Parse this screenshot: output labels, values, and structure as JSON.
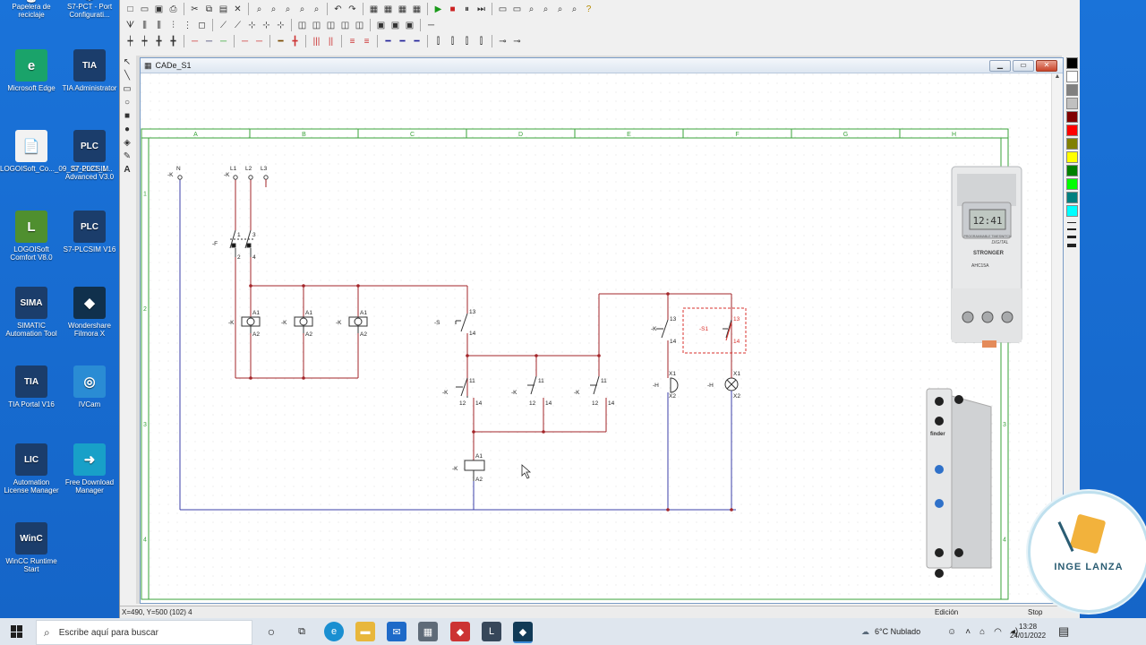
{
  "desktop_icons": [
    {
      "label": "Papelera de reciclaje",
      "icon": "recycle-bin-icon",
      "color": "#8fa4b8",
      "glyph": "🗑"
    },
    {
      "label": "S7-PCT - Port Configurati...",
      "icon": "s7-pct-icon",
      "color": "#2e6aa8",
      "glyph": "⚙"
    },
    {
      "label": "Microsoft Edge",
      "icon": "edge-icon",
      "color": "#1aa36a",
      "glyph": "e"
    },
    {
      "label": "TIA Administrator",
      "icon": "tia-admin-icon",
      "color": "#1b3d6b",
      "glyph": "TIA"
    },
    {
      "label": "LOGOISoft_Co..._09_27_2021_1...",
      "icon": "document-icon",
      "color": "#f2f2f2",
      "glyph": "📄"
    },
    {
      "label": "S7-PLCSIM Advanced V3.0",
      "icon": "plcsim-adv-icon",
      "color": "#1b3d6b",
      "glyph": "PLC"
    },
    {
      "label": "LOGOISoft Comfort V8.0",
      "icon": "logosoft-icon",
      "color": "#4f8f2f",
      "glyph": "L"
    },
    {
      "label": "S7-PLCSIM V16",
      "icon": "plcsim-icon",
      "color": "#1b3d6b",
      "glyph": "PLC"
    },
    {
      "label": "SIMATIC Automation Tool",
      "icon": "simatic-icon",
      "color": "#1b3d6b",
      "glyph": "SIMA"
    },
    {
      "label": "Wondershare Filmora X",
      "icon": "filmora-icon",
      "color": "#10304c",
      "glyph": "◆"
    },
    {
      "label": "TIA Portal V16",
      "icon": "tia-portal-icon",
      "color": "#1b3d6b",
      "glyph": "TIA"
    },
    {
      "label": "IVCam",
      "icon": "ivcam-icon",
      "color": "#2a8cd4",
      "glyph": "◎"
    },
    {
      "label": "Automation License Manager",
      "icon": "license-icon",
      "color": "#1b3d6b",
      "glyph": "LIC"
    },
    {
      "label": "Free Download Manager",
      "icon": "fdm-icon",
      "color": "#18a0c8",
      "glyph": "➜"
    },
    {
      "label": "WinCC Runtime Start",
      "icon": "wincc-icon",
      "color": "#1b3d6b",
      "glyph": "WinC"
    }
  ],
  "document": {
    "title": "CADe_S1",
    "columns": [
      "A",
      "B",
      "C",
      "D",
      "E",
      "F",
      "G",
      "H"
    ],
    "rows": [
      "1",
      "2",
      "3",
      "4"
    ]
  },
  "schematic": {
    "labels": {
      "kn": "-K",
      "n": "N",
      "kl": "-K",
      "l1": "L1",
      "l2": "L2",
      "l3": "L3",
      "f": "-F",
      "f1": "1",
      "f2": "2",
      "f3": "3",
      "f4": "4",
      "k1": "-K",
      "k1a1": "A1",
      "k1a2": "A2",
      "k2": "-K",
      "k2a1": "A1",
      "k2a2": "A2",
      "k3": "-K",
      "k3a1": "A1",
      "k3a2": "A2",
      "s": "-S",
      "s13": "13",
      "s14": "14",
      "ka": "-K",
      "ka11": "11",
      "ka12": "12",
      "ka14": "14",
      "kb": "-K",
      "kb11": "11",
      "kb12": "12",
      "kb14": "14",
      "kc": "-K",
      "kc11": "11",
      "kc12": "12",
      "kc14": "14",
      "kt": "-K",
      "kta1": "A1",
      "kta2": "A2",
      "kd": "-K",
      "kd13": "13",
      "kd14": "14",
      "s1": "-S1",
      "s113": "13",
      "s114": "14",
      "h1": "-H",
      "h1x1": "X1",
      "h1x2": "X2",
      "h2": "-H",
      "h2x1": "X1",
      "h2x2": "X2"
    }
  },
  "device_timer": {
    "display": "12:41",
    "brand": "STRONGER",
    "model": "AHC15A",
    "caption": "PROGRAMMABLE TIMESWITCH",
    "caption2": "DIGITAL"
  },
  "device_relay": {
    "brand": "finder"
  },
  "status": {
    "coords": "X=490, Y=500 (102) 4",
    "mode": "Edición",
    "state": "Stop"
  },
  "taskbar": {
    "search_placeholder": "Escribe aquí para buscar",
    "weather": "6°C Nublado",
    "time": "13:28",
    "date": "24/01/2022"
  },
  "watermark": {
    "text": "INGE LANZA"
  },
  "palette": [
    "#000000",
    "#ffffff",
    "#808080",
    "#c0c0c0",
    "#800000",
    "#ff0000",
    "#808000",
    "#ffff00",
    "#008000",
    "#00ff00",
    "#008080",
    "#00ffff"
  ],
  "colors": {
    "wire_red": "#a3262a",
    "wire_blue": "#3b3fa8",
    "frame_green": "#3aa33a",
    "dash_red": "#d9302c"
  }
}
